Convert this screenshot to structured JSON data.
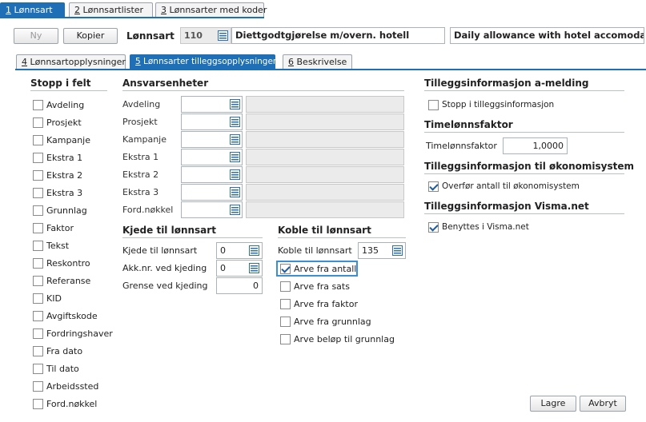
{
  "top_tabs": [
    {
      "num": "1",
      "label": "Lønnsart",
      "active": true
    },
    {
      "num": "2",
      "label": "Lønnsartlister",
      "active": false
    },
    {
      "num": "3",
      "label": "Lønnsarter med koder",
      "active": false
    }
  ],
  "toolbar": {
    "new_label": "Ny",
    "copy_label": "Kopier",
    "wagetype_label": "Lønnsart",
    "wagetype_number": "110",
    "description_no": "Diettgodtgjørelse m/overn. hotell",
    "description_en": "Daily allowance with hotel accomodation"
  },
  "sub_tabs": [
    {
      "num": "4",
      "label": "Lønnsartopplysninger",
      "active": false
    },
    {
      "num": "5",
      "label": "Lønnsarter tilleggsopplysninger",
      "active": true
    },
    {
      "num": "6",
      "label": "Beskrivelse",
      "active": false
    }
  ],
  "stop_in_field": {
    "title": "Stopp i felt",
    "items": [
      "Avdeling",
      "Prosjekt",
      "Kampanje",
      "Ekstra 1",
      "Ekstra 2",
      "Ekstra 3",
      "Grunnlag",
      "Faktor",
      "Tekst",
      "Reskontro",
      "Referanse",
      "KID",
      "Avgiftskode",
      "Fordringshaver",
      "Fra dato",
      "Til dato",
      "Arbeidssted",
      "Ford.nøkkel"
    ]
  },
  "responsibility": {
    "title": "Ansvarsenheter",
    "rows": [
      "Avdeling",
      "Prosjekt",
      "Kampanje",
      "Ekstra 1",
      "Ekstra 2",
      "Ekstra 3",
      "Ford.nøkkel"
    ]
  },
  "chain": {
    "title": "Kjede til lønnsart",
    "chain_label": "Kjede til lønnsart",
    "chain_value": "0",
    "acc_label": "Akk.nr. ved kjeding",
    "acc_value": "0",
    "limit_label": "Grense ved kjeding",
    "limit_value": "0"
  },
  "link": {
    "title": "Koble til lønnsart",
    "link_label": "Koble til lønnsart",
    "link_value": "135",
    "options": [
      {
        "label": "Arve fra antall",
        "checked": true
      },
      {
        "label": "Arve fra sats",
        "checked": false
      },
      {
        "label": "Arve fra faktor",
        "checked": false
      },
      {
        "label": "Arve fra grunnlag",
        "checked": false
      },
      {
        "label": "Arve beløp til grunnlag",
        "checked": false
      }
    ]
  },
  "a_melding": {
    "title": "Tilleggsinformasjon a-melding",
    "stop_label": "Stopp i tilleggsinformasjon"
  },
  "hourly": {
    "title": "Timelønnsfaktor",
    "label": "Timelønnsfaktor",
    "value": "1,0000"
  },
  "econ": {
    "title": "Tilleggsinformasjon til økonomisystem",
    "transfer_label": "Overfør antall til økonomisystem"
  },
  "visma": {
    "title": "Tilleggsinformasjon Visma.net",
    "used_label": "Benyttes i Visma.net"
  },
  "footer": {
    "save_label": "Lagre",
    "cancel_label": "Avbryt"
  }
}
